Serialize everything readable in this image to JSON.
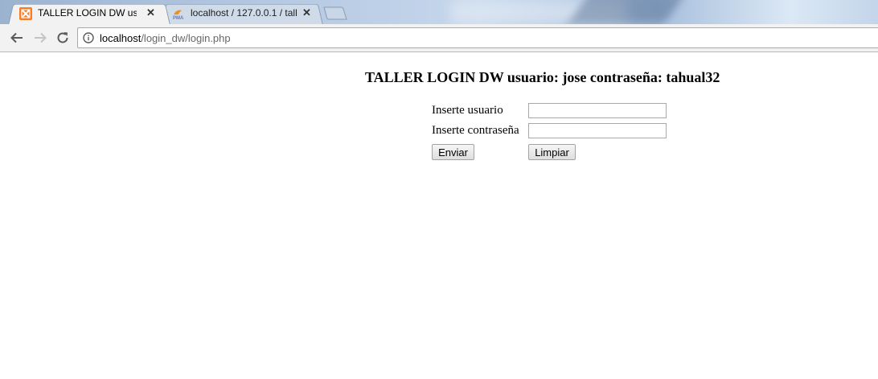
{
  "tabs": [
    {
      "title": "TALLER LOGIN DW usuar",
      "favicon": "xampp-icon",
      "active": true
    },
    {
      "title": "localhost / 127.0.0.1 / tall",
      "favicon": "phpmyadmin-icon",
      "active": false
    }
  ],
  "address_bar": {
    "host": "localhost",
    "path": "/login_dw/login.php"
  },
  "page": {
    "title": "TALLER LOGIN DW usuario: jose contraseña: tahual32",
    "form": {
      "username_label": "Inserte usuario",
      "password_label": "Inserte contraseña",
      "username_value": "",
      "password_value": "",
      "submit_label": "Enviar",
      "reset_label": "Limpiar"
    }
  },
  "colors": {
    "xampp_orange": "#fb7a24",
    "tab_active_bg": "#f2f2f2",
    "toolbar_bg": "#f2f2f2"
  }
}
